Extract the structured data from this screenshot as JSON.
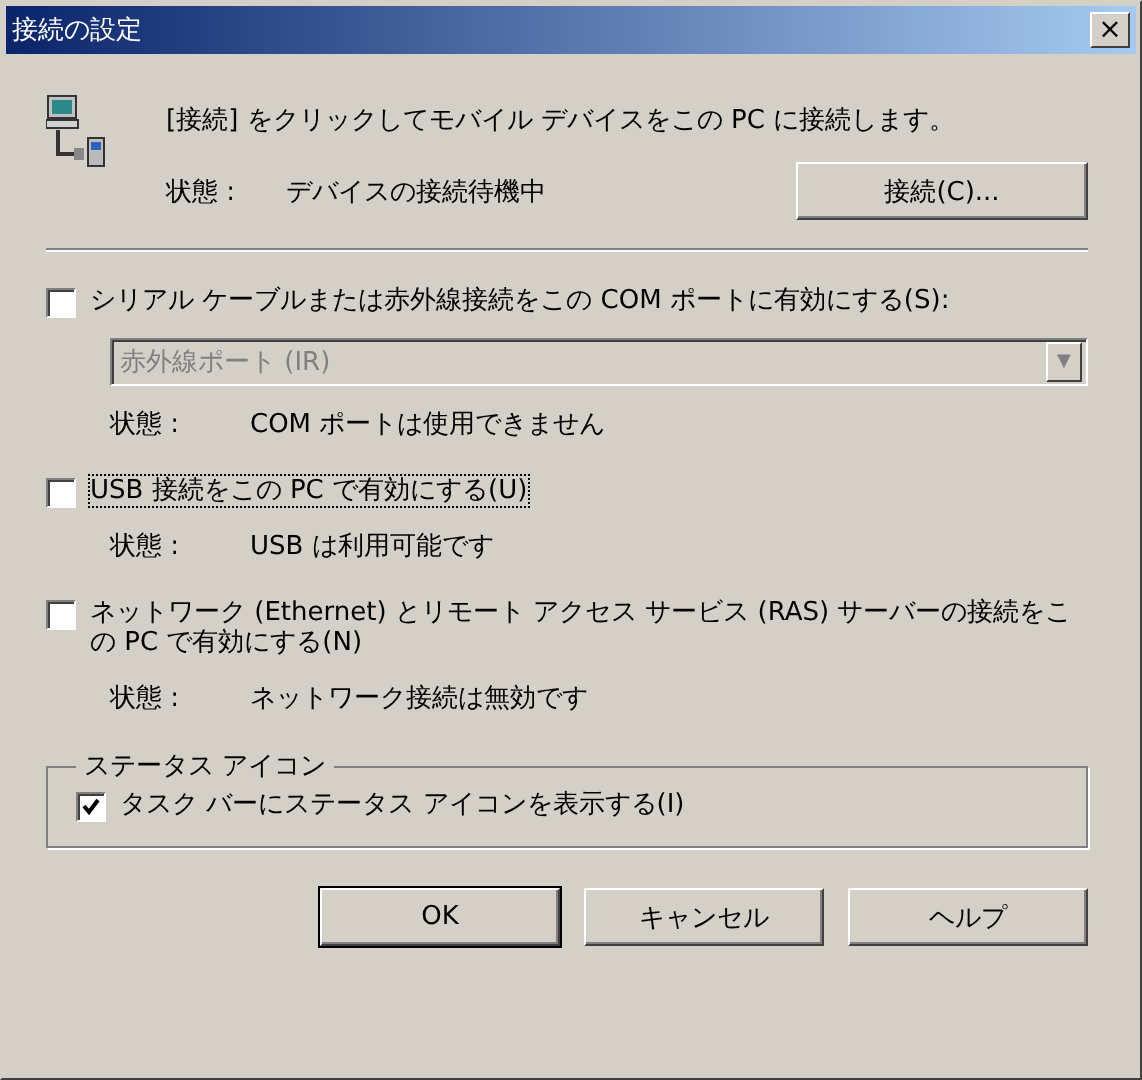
{
  "window": {
    "title": "接続の設定",
    "close": "×"
  },
  "intro": "[接続] をクリックしてモバイル デバイスをこの PC に接続します。",
  "connection_status": {
    "label": "状態 :",
    "value": "デバイスの接続待機中"
  },
  "connect_button": "接続(C)...",
  "options": [
    {
      "label": "シリアル ケーブルまたは赤外線接続をこの COM ポートに有効にする(S):",
      "checked": false,
      "focused": false,
      "dropdown": {
        "value": "赤外線ポート (IR)",
        "disabled": true,
        "arrow": "▼"
      },
      "status": {
        "label": "状態 :",
        "value": "COM ポートは使用できません"
      }
    },
    {
      "label": "USB 接続をこの PC で有効にする(U)",
      "checked": false,
      "focused": true,
      "status": {
        "label": "状態 :",
        "value": "USB は利用可能です"
      }
    },
    {
      "label": "ネットワーク (Ethernet) とリモート アクセス サービス (RAS) サーバーの接続をこの PC で有効にする(N)",
      "checked": false,
      "focused": false,
      "status": {
        "label": "状態 :",
        "value": "ネットワーク接続は無効です"
      }
    }
  ],
  "status_icon_group": {
    "legend": "ステータス アイコン",
    "checkbox": {
      "label": "タスク バーにステータス アイコンを表示する(I)",
      "checked": true
    }
  },
  "buttons": [
    {
      "label": "OK",
      "default": true
    },
    {
      "label": "キャンセル",
      "default": false
    },
    {
      "label": "ヘルプ",
      "default": false
    }
  ]
}
